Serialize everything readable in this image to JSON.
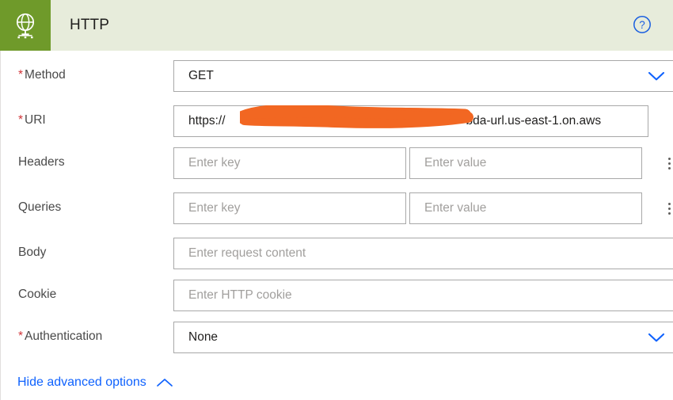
{
  "header": {
    "title": "HTTP",
    "icon": "globe-network-icon",
    "help_icon": "help-question-icon",
    "bg_color": "#e7ecdb",
    "icon_bg_color": "#6f9a2a"
  },
  "colors": {
    "accent_blue": "#0f62fe",
    "required_red": "#d13438",
    "green": "#6f9a2a",
    "redaction_orange": "#f26722"
  },
  "fields": {
    "method": {
      "label": "Method",
      "required_marker": "*",
      "required": true,
      "value": "GET",
      "control": "dropdown"
    },
    "uri": {
      "label": "URI",
      "required_marker": "*",
      "required": true,
      "value_prefix": "https://",
      "value_suffix": "bda-url.us-east-1.on.aws",
      "redacted": true,
      "control": "text"
    },
    "headers": {
      "label": "Headers",
      "required": false,
      "key_placeholder": "Enter key",
      "value_placeholder": "Enter value",
      "key_value": "",
      "value_value": "",
      "menu_icon": "kebab-menu-icon",
      "control": "key-value"
    },
    "queries": {
      "label": "Queries",
      "required": false,
      "key_placeholder": "Enter key",
      "value_placeholder": "Enter value",
      "key_value": "",
      "value_value": "",
      "menu_icon": "kebab-menu-icon",
      "control": "key-value"
    },
    "body": {
      "label": "Body",
      "required": false,
      "placeholder": "Enter request content",
      "value": "",
      "control": "text"
    },
    "cookie": {
      "label": "Cookie",
      "required": false,
      "placeholder": "Enter HTTP cookie",
      "value": "",
      "control": "text"
    },
    "authentication": {
      "label": "Authentication",
      "required_marker": "*",
      "required": true,
      "value": "None",
      "control": "dropdown"
    }
  },
  "advanced_options": {
    "label": "Hide advanced options",
    "icon": "chevron-up-icon",
    "expanded": true
  }
}
